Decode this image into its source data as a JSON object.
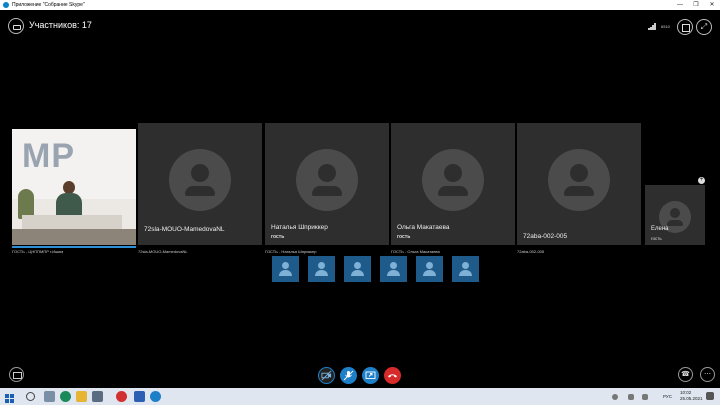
{
  "window": {
    "title": "Приложение \"Собрание Skype\"",
    "controls": [
      "—",
      "❐",
      "✕"
    ]
  },
  "header": {
    "participants_label": "Участников: 17",
    "quality_text": "6510"
  },
  "video_tile": {
    "wall_text": "МР",
    "caption": "ГОСТЬ - ЦНППМПР г.Ишим"
  },
  "tiles": [
    {
      "name": "72sla-MOUO-MamedovaNL",
      "role": "",
      "caption": "72sla-MOUO-MamedovaNL"
    },
    {
      "name": "Наталья Шприккер",
      "role": "гость",
      "caption": "ГОСТЬ - Наталья Шприккер"
    },
    {
      "name": "Ольга Макатаева",
      "role": "гость",
      "caption": "ГОСТЬ - Ольга Макатаева"
    },
    {
      "name": "72aba-002-005",
      "role": "",
      "caption": "72aba-002-005"
    }
  ],
  "small_tile": {
    "name": "Елена",
    "role": "гость"
  },
  "thumbnail_count": 6,
  "controls": {
    "right_call_icon": "☎",
    "more_icon": "⋯"
  },
  "taskbar": {
    "lang": "РУС",
    "time": "10:02",
    "date": "25.05.2021"
  },
  "colors": {
    "accent": "#1e7fc9",
    "hangup": "#d72a2a",
    "tile_bg": "#2e2e2e",
    "thumb_bg": "#1f5b8a"
  }
}
